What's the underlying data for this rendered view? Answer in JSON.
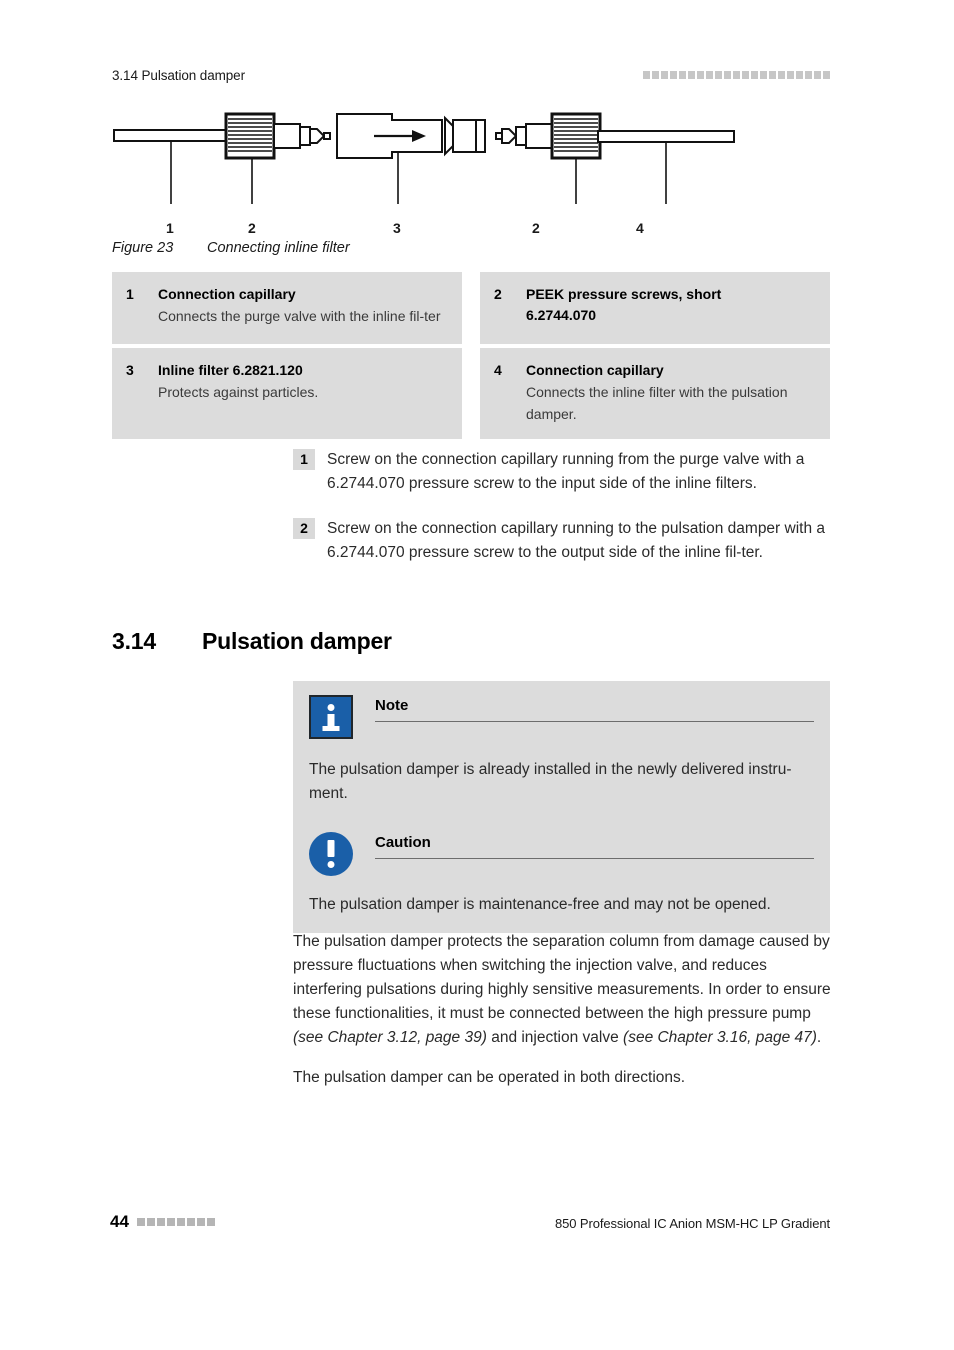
{
  "header": {
    "running_title": "3.14 Pulsation damper",
    "marker_squares": 21
  },
  "figure": {
    "callout_labels": [
      "1",
      "2",
      "3",
      "2",
      "4"
    ],
    "caption_number": "Figure 23",
    "caption_text": "Connecting inline filter",
    "flow_arrow": "flow-direction-arrow"
  },
  "legend": {
    "items": [
      {
        "number": "1",
        "title": "Connection capillary",
        "description": "Connects the purge valve with the inline fil-ter"
      },
      {
        "number": "2",
        "title": "PEEK pressure screws, short",
        "title2": "6.2744.070",
        "description": ""
      },
      {
        "number": "3",
        "title": "Inline filter 6.2821.120",
        "description": "Protects against particles."
      },
      {
        "number": "4",
        "title": "Connection capillary",
        "description": "Connects the inline filter with the pulsation damper."
      }
    ]
  },
  "steps": [
    {
      "number": "1",
      "text": "Screw on the connection capillary running from the purge valve with a 6.2744.070 pressure screw to the input side of the inline filters."
    },
    {
      "number": "2",
      "text": "Screw on the connection capillary running to the pulsation damper with a 6.2744.070 pressure screw to the output side of the inline fil-ter."
    }
  ],
  "section": {
    "number": "3.14",
    "title": "Pulsation damper"
  },
  "note": {
    "icon": "info-icon",
    "title": "Note",
    "body": "The pulsation damper is already installed in the newly delivered instru-ment.",
    "icon_color": "#1a5fa8"
  },
  "caution": {
    "icon": "caution-icon",
    "title": "Caution",
    "body": "The pulsation damper is maintenance-free and may not be opened.",
    "icon_color": "#1a5fa8"
  },
  "body": {
    "paragraph1_a": "The pulsation damper protects the separation column from damage caused by pressure fluctuations when switching the injection valve, and reduces interfering pulsations during highly sensitive measurements. In order to ensure these functionalities, it must be connected between the high pressure pump ",
    "paragraph1_ref1": "(see Chapter 3.12, page 39)",
    "paragraph1_b": " and injection valve ",
    "paragraph1_ref2": "(see Chapter 3.16, page 47)",
    "paragraph1_c": ".",
    "paragraph2": "The pulsation damper can be operated in both directions."
  },
  "footer": {
    "page_number": "44",
    "marker_squares": 8,
    "document_title": "850 Professional IC Anion MSM-HC LP Gradient"
  }
}
